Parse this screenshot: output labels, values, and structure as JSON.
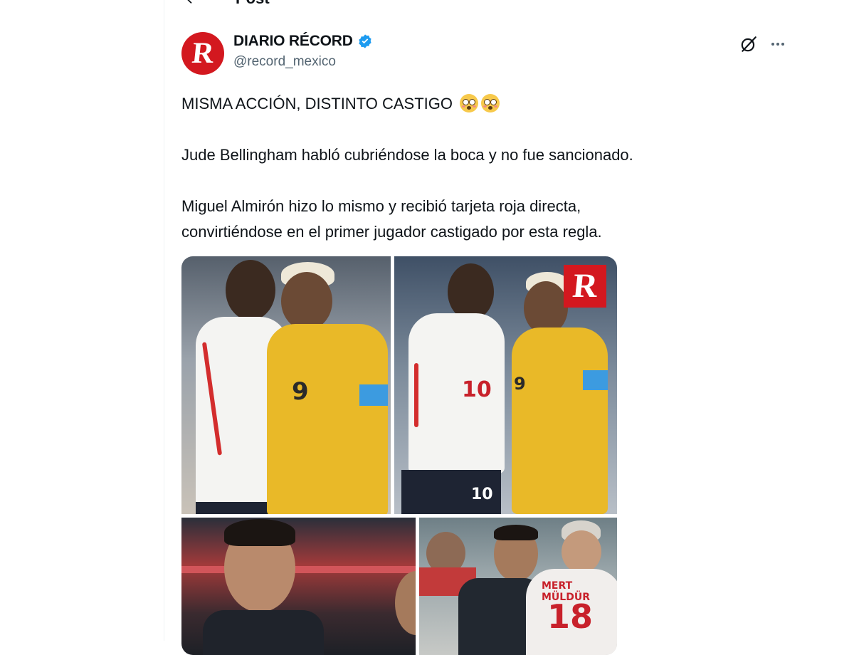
{
  "header": {
    "back_icon": "arrow-left-icon",
    "title": "Post"
  },
  "tweet": {
    "author": {
      "name": "DIARIO RÉCORD",
      "handle": "@record_mexico",
      "avatar_letter": "R",
      "verified": true,
      "verified_color": "#1d9bf0",
      "brand_color": "#d3181f"
    },
    "actions": {
      "grok_icon": "grok-icon",
      "more_icon": "more-horizontal-icon"
    },
    "text": {
      "line1": "MISMA ACCIÓN, DISTINTO CASTIGO",
      "line2": "Jude Bellingham habló cubriéndose la boca y no fue sancionado.",
      "line3": "Miguel Almirón hizo lo mismo y recibió tarjeta roja directa,",
      "line4": "convirtiéndose en el primer jugador castigado por esta regla."
    },
    "media": {
      "photos": [
        {
          "jersey_numbers": [
            "9"
          ]
        },
        {
          "jersey_numbers": [
            "10",
            "10",
            "9"
          ],
          "watermark": "R"
        },
        {
          "jersey_numbers": []
        },
        {
          "player_name": "MERT MÜLDÜR",
          "jersey_numbers": [
            "18"
          ]
        }
      ]
    }
  }
}
